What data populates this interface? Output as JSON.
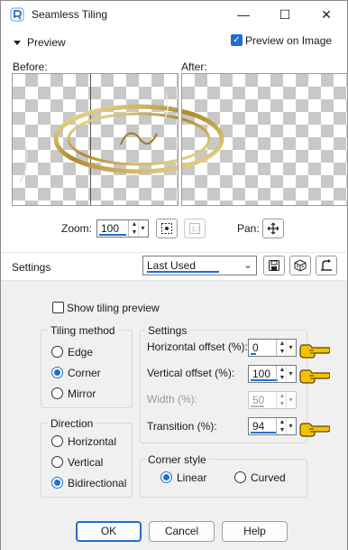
{
  "window": {
    "title": "Seamless Tiling",
    "minimize": "—",
    "maximize": "☐",
    "close": "✕"
  },
  "preview": {
    "toggle_label": "Preview",
    "preview_on_image_label": "Preview on Image",
    "preview_on_image_checked": true,
    "before_label": "Before:",
    "after_label": "After:",
    "zoom_label": "Zoom:",
    "zoom_value": "100",
    "pan_label": "Pan:"
  },
  "settings_bar": {
    "label": "Settings",
    "preset": "Last Used"
  },
  "show_tiling_preview": {
    "label": "Show tiling preview",
    "checked": false
  },
  "tiling_method": {
    "title": "Tiling method",
    "options": [
      {
        "label": "Edge",
        "selected": false
      },
      {
        "label": "Corner",
        "selected": true
      },
      {
        "label": "Mirror",
        "selected": false
      }
    ]
  },
  "direction": {
    "title": "Direction",
    "options": [
      {
        "label": "Horizontal",
        "selected": false
      },
      {
        "label": "Vertical",
        "selected": false
      },
      {
        "label": "Bidirectional",
        "selected": true
      }
    ]
  },
  "settings": {
    "title": "Settings",
    "horizontal_offset": {
      "label": "Horizontal offset (%):",
      "value": "0",
      "level": 0.0
    },
    "vertical_offset": {
      "label": "Vertical offset (%):",
      "value": "100",
      "level": 1.0
    },
    "width": {
      "label": "Width (%):",
      "value": "50",
      "level": 0.5,
      "disabled": true
    },
    "transition": {
      "label": "Transition (%):",
      "value": "94",
      "level": 0.94
    }
  },
  "corner_style": {
    "title": "Corner style",
    "options": [
      {
        "label": "Linear",
        "selected": true
      },
      {
        "label": "Curved",
        "selected": false
      }
    ]
  },
  "buttons": {
    "ok": "OK",
    "cancel": "Cancel",
    "help": "Help"
  },
  "colors": {
    "accent": "#1f6fd1",
    "pointer_hand": "#f2c200"
  },
  "icons": [
    "app-icon",
    "collapse-arrow-icon",
    "proof-icon",
    "one-to-one-icon",
    "pan-move-icon",
    "save-preset-icon",
    "randomize-icon",
    "reset-icon",
    "pointing-hand-icon"
  ]
}
